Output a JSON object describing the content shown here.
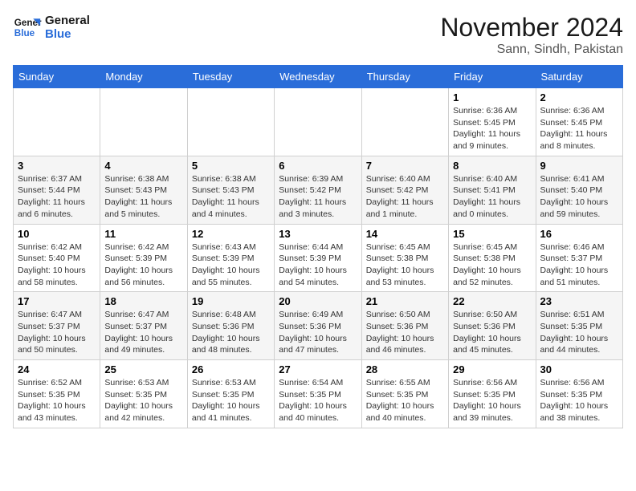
{
  "header": {
    "logo_line1": "General",
    "logo_line2": "Blue",
    "month": "November 2024",
    "location": "Sann, Sindh, Pakistan"
  },
  "weekdays": [
    "Sunday",
    "Monday",
    "Tuesday",
    "Wednesday",
    "Thursday",
    "Friday",
    "Saturday"
  ],
  "weeks": [
    [
      {
        "day": "",
        "info": ""
      },
      {
        "day": "",
        "info": ""
      },
      {
        "day": "",
        "info": ""
      },
      {
        "day": "",
        "info": ""
      },
      {
        "day": "",
        "info": ""
      },
      {
        "day": "1",
        "info": "Sunrise: 6:36 AM\nSunset: 5:45 PM\nDaylight: 11 hours and 9 minutes."
      },
      {
        "day": "2",
        "info": "Sunrise: 6:36 AM\nSunset: 5:45 PM\nDaylight: 11 hours and 8 minutes."
      }
    ],
    [
      {
        "day": "3",
        "info": "Sunrise: 6:37 AM\nSunset: 5:44 PM\nDaylight: 11 hours and 6 minutes."
      },
      {
        "day": "4",
        "info": "Sunrise: 6:38 AM\nSunset: 5:43 PM\nDaylight: 11 hours and 5 minutes."
      },
      {
        "day": "5",
        "info": "Sunrise: 6:38 AM\nSunset: 5:43 PM\nDaylight: 11 hours and 4 minutes."
      },
      {
        "day": "6",
        "info": "Sunrise: 6:39 AM\nSunset: 5:42 PM\nDaylight: 11 hours and 3 minutes."
      },
      {
        "day": "7",
        "info": "Sunrise: 6:40 AM\nSunset: 5:42 PM\nDaylight: 11 hours and 1 minute."
      },
      {
        "day": "8",
        "info": "Sunrise: 6:40 AM\nSunset: 5:41 PM\nDaylight: 11 hours and 0 minutes."
      },
      {
        "day": "9",
        "info": "Sunrise: 6:41 AM\nSunset: 5:40 PM\nDaylight: 10 hours and 59 minutes."
      }
    ],
    [
      {
        "day": "10",
        "info": "Sunrise: 6:42 AM\nSunset: 5:40 PM\nDaylight: 10 hours and 58 minutes."
      },
      {
        "day": "11",
        "info": "Sunrise: 6:42 AM\nSunset: 5:39 PM\nDaylight: 10 hours and 56 minutes."
      },
      {
        "day": "12",
        "info": "Sunrise: 6:43 AM\nSunset: 5:39 PM\nDaylight: 10 hours and 55 minutes."
      },
      {
        "day": "13",
        "info": "Sunrise: 6:44 AM\nSunset: 5:39 PM\nDaylight: 10 hours and 54 minutes."
      },
      {
        "day": "14",
        "info": "Sunrise: 6:45 AM\nSunset: 5:38 PM\nDaylight: 10 hours and 53 minutes."
      },
      {
        "day": "15",
        "info": "Sunrise: 6:45 AM\nSunset: 5:38 PM\nDaylight: 10 hours and 52 minutes."
      },
      {
        "day": "16",
        "info": "Sunrise: 6:46 AM\nSunset: 5:37 PM\nDaylight: 10 hours and 51 minutes."
      }
    ],
    [
      {
        "day": "17",
        "info": "Sunrise: 6:47 AM\nSunset: 5:37 PM\nDaylight: 10 hours and 50 minutes."
      },
      {
        "day": "18",
        "info": "Sunrise: 6:47 AM\nSunset: 5:37 PM\nDaylight: 10 hours and 49 minutes."
      },
      {
        "day": "19",
        "info": "Sunrise: 6:48 AM\nSunset: 5:36 PM\nDaylight: 10 hours and 48 minutes."
      },
      {
        "day": "20",
        "info": "Sunrise: 6:49 AM\nSunset: 5:36 PM\nDaylight: 10 hours and 47 minutes."
      },
      {
        "day": "21",
        "info": "Sunrise: 6:50 AM\nSunset: 5:36 PM\nDaylight: 10 hours and 46 minutes."
      },
      {
        "day": "22",
        "info": "Sunrise: 6:50 AM\nSunset: 5:36 PM\nDaylight: 10 hours and 45 minutes."
      },
      {
        "day": "23",
        "info": "Sunrise: 6:51 AM\nSunset: 5:35 PM\nDaylight: 10 hours and 44 minutes."
      }
    ],
    [
      {
        "day": "24",
        "info": "Sunrise: 6:52 AM\nSunset: 5:35 PM\nDaylight: 10 hours and 43 minutes."
      },
      {
        "day": "25",
        "info": "Sunrise: 6:53 AM\nSunset: 5:35 PM\nDaylight: 10 hours and 42 minutes."
      },
      {
        "day": "26",
        "info": "Sunrise: 6:53 AM\nSunset: 5:35 PM\nDaylight: 10 hours and 41 minutes."
      },
      {
        "day": "27",
        "info": "Sunrise: 6:54 AM\nSunset: 5:35 PM\nDaylight: 10 hours and 40 minutes."
      },
      {
        "day": "28",
        "info": "Sunrise: 6:55 AM\nSunset: 5:35 PM\nDaylight: 10 hours and 40 minutes."
      },
      {
        "day": "29",
        "info": "Sunrise: 6:56 AM\nSunset: 5:35 PM\nDaylight: 10 hours and 39 minutes."
      },
      {
        "day": "30",
        "info": "Sunrise: 6:56 AM\nSunset: 5:35 PM\nDaylight: 10 hours and 38 minutes."
      }
    ]
  ]
}
